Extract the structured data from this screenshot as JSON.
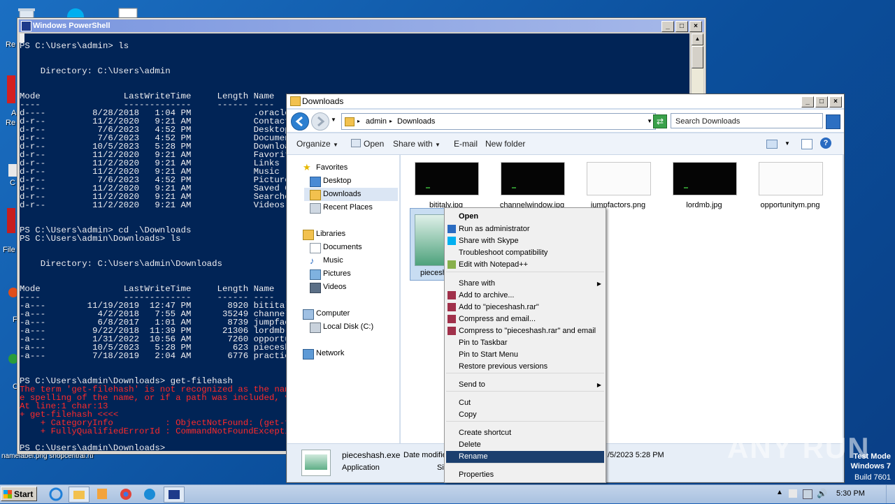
{
  "desktop": {
    "icons": [
      {
        "name": "recycle-bin-icon",
        "label": "Re"
      },
      {
        "name": "skype-icon",
        "label": ""
      },
      {
        "name": "document-icon",
        "label": ""
      }
    ],
    "left_labels": [
      "Re",
      "A",
      "Re",
      "C",
      "File",
      "F",
      "C"
    ],
    "bottom_text": "namelabel.png  shopcentral.rtf"
  },
  "powershell": {
    "title": "Windows PowerShell",
    "lines": [
      "PS C:\\Users\\admin> ls",
      "",
      "",
      "    Directory: C:\\Users\\admin",
      "",
      "",
      "Mode                LastWriteTime     Length Name",
      "----                -------------     ------ ----",
      "d----         8/28/2018   1:04 PM            .oracle_jre_usage",
      "d-r--         11/2/2020   9:21 AM            Contacts",
      "d-r--          7/6/2023   4:52 PM            Desktop",
      "d-r--          7/6/2023   4:52 PM            Documents",
      "d-r--         10/5/2023   5:28 PM            Downloads",
      "d-r--         11/2/2020   9:21 AM            Favorites",
      "d-r--         11/2/2020   9:21 AM            Links",
      "d-r--         11/2/2020   9:21 AM            Music",
      "d-r--          7/6/2023   4:52 PM            Pictures",
      "d-r--         11/2/2020   9:21 AM            Saved Games",
      "d-r--         11/2/2020   9:21 AM            Searches",
      "d-r--         11/2/2020   9:21 AM            Videos",
      "",
      "",
      "PS C:\\Users\\admin> cd .\\Downloads",
      "PS C:\\Users\\admin\\Downloads> ls",
      "",
      "",
      "    Directory: C:\\Users\\admin\\Downloads",
      "",
      "",
      "Mode                LastWriteTime     Length Name",
      "----                -------------     ------ ----",
      "-a---        11/19/2019  12:47 PM       8920 bititaly.jpg",
      "-a---          4/2/2018   7:55 AM      35249 channelwindow.jpg",
      "-a---          6/8/2017   1:01 AM       8739 jumpfactors.png",
      "-a---         9/22/2018  11:39 PM      21306 lordmb.jpg",
      "-a---         1/31/2022  10:56 AM       7260 opportunitym.png",
      "-a---         10/5/2023   5:28 PM        623 pieceshash.exe",
      "-a---         7/18/2019   2:04 AM       6776 practice.png",
      "",
      "",
      "PS C:\\Users\\admin\\Downloads> get-filehash"
    ],
    "error_lines": [
      "The term 'get-filehash' is not recognized as the name of a cmdlet, function, script file, or operable program. Check th",
      "e spelling of the name, or if a path was included, verify that the path is correct and try again.",
      "At line:1 char:13",
      "+ get-filehash <<<<",
      "    + CategoryInfo          : ObjectNotFound: (get-filehash:String) [], CommandNotFoundException",
      "    + FullyQualifiedErrorId : CommandNotFoundException"
    ],
    "prompt_last": "PS C:\\Users\\admin\\Downloads> "
  },
  "explorer": {
    "title": "Downloads",
    "breadcrumb": [
      "admin",
      "Downloads"
    ],
    "search_placeholder": "Search Downloads",
    "toolbar": {
      "organize": "Organize",
      "open": "Open",
      "share_with": "Share with",
      "email": "E-mail",
      "new_folder": "New folder"
    },
    "nav": {
      "favorites": "Favorites",
      "desktop": "Desktop",
      "downloads": "Downloads",
      "recent_places": "Recent Places",
      "libraries": "Libraries",
      "documents": "Documents",
      "music": "Music",
      "pictures": "Pictures",
      "videos": "Videos",
      "computer": "Computer",
      "local_disk": "Local Disk (C:)",
      "network": "Network"
    },
    "files": [
      {
        "name": "bititaly.jpg",
        "style": "dark"
      },
      {
        "name": "channelwindow.jpg",
        "style": "dark"
      },
      {
        "name": "jumpfactors.png",
        "style": "light"
      },
      {
        "name": "lordmb.jpg",
        "style": "dark"
      },
      {
        "name": "opportunitym.png",
        "style": "light"
      }
    ],
    "selected_file_label": "piecesh",
    "details": {
      "name": "pieceshash.exe",
      "type": "Application",
      "date_label": "Date modifie",
      "size_label": "Si",
      "date_value": "/5/2023 5:28 PM"
    }
  },
  "context_menu": {
    "items": [
      {
        "label": "Open",
        "bold": true
      },
      {
        "label": "Run as administrator",
        "icon": "shield-icon"
      },
      {
        "label": "Share with Skype",
        "icon": "skype-icon"
      },
      {
        "label": "Troubleshoot compatibility"
      },
      {
        "label": "Edit with Notepad++",
        "icon": "notepad-icon"
      },
      {
        "label": "Share with",
        "submenu": true
      },
      {
        "label": "Add to archive...",
        "icon": "winrar-icon"
      },
      {
        "label": "Add to \"pieceshash.rar\"",
        "icon": "winrar-icon"
      },
      {
        "label": "Compress and email...",
        "icon": "winrar-icon"
      },
      {
        "label": "Compress to \"pieceshash.rar\" and email",
        "icon": "winrar-icon"
      },
      {
        "label": "Pin to Taskbar"
      },
      {
        "label": "Pin to Start Menu"
      },
      {
        "label": "Restore previous versions"
      },
      {
        "label": "Send to",
        "submenu": true
      },
      {
        "label": "Cut"
      },
      {
        "label": "Copy"
      },
      {
        "label": "Create shortcut"
      },
      {
        "label": "Delete"
      },
      {
        "label": "Rename",
        "highlighted": true
      },
      {
        "label": "Properties"
      }
    ]
  },
  "taskbar": {
    "start_label": "Start",
    "time": "5:30 PM"
  },
  "watermark": {
    "line1": "Test Mode",
    "line2": "Windows 7",
    "line3": "Build 7601",
    "brand": "ANY RUN"
  }
}
